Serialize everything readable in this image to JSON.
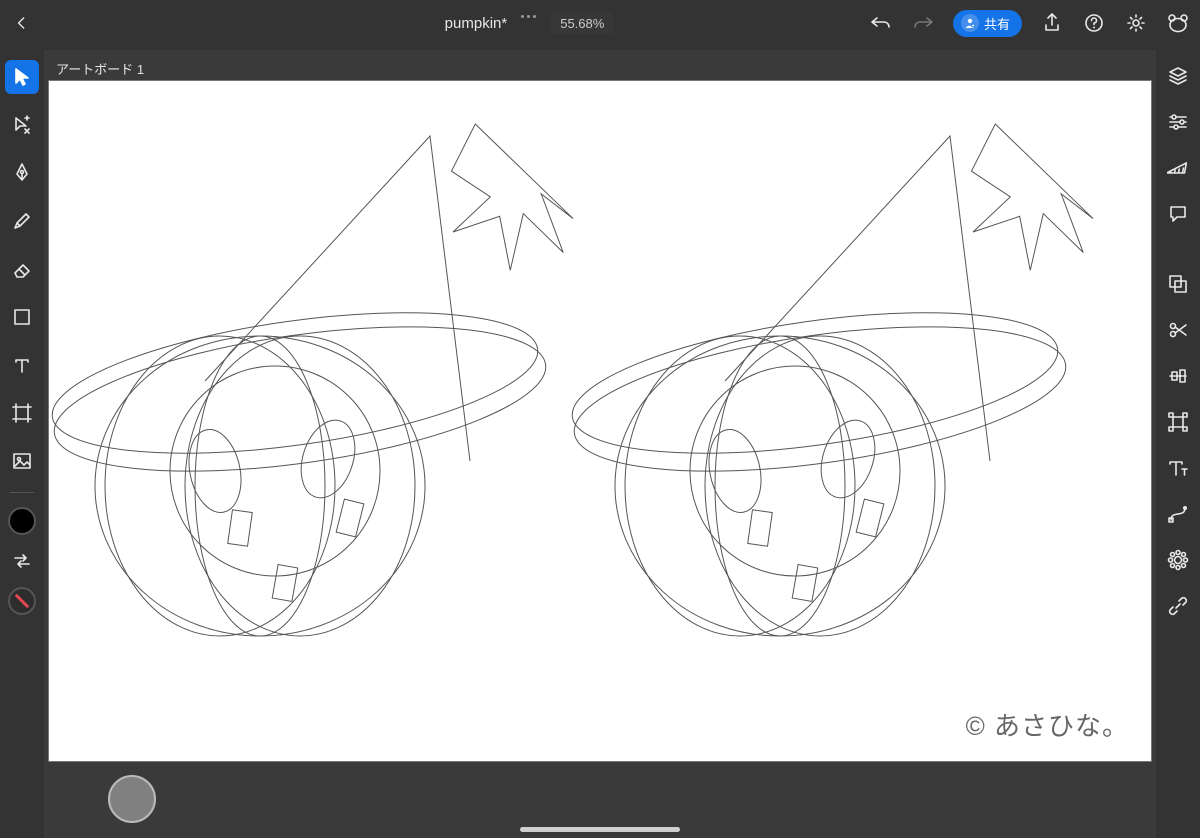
{
  "header": {
    "doc_title": "pumpkin*",
    "zoom": "55.68%",
    "share_label": "共有"
  },
  "artboard": {
    "label": "アートボード 1",
    "copyright": "© あさひな。"
  },
  "colors": {
    "accent": "#1473e6",
    "fill": "#000000",
    "stroke": "none",
    "bottom_chip": "#808080"
  },
  "left_tools": [
    {
      "name": "selection-tool",
      "selected": true
    },
    {
      "name": "direct-selection-tool",
      "selected": false
    },
    {
      "name": "pen-tool",
      "selected": false
    },
    {
      "name": "pencil-tool",
      "selected": false
    },
    {
      "name": "eraser-tool",
      "selected": false
    },
    {
      "name": "shape-tool",
      "selected": false
    },
    {
      "name": "type-tool",
      "selected": false
    },
    {
      "name": "artboard-tool",
      "selected": false
    },
    {
      "name": "place-image-tool",
      "selected": false
    }
  ],
  "right_panels": [
    {
      "name": "layers-panel-icon"
    },
    {
      "name": "properties-panel-icon"
    },
    {
      "name": "precision-panel-icon"
    },
    {
      "name": "comments-panel-icon"
    },
    {
      "name": "combine-shapes-icon"
    },
    {
      "name": "scissors-icon"
    },
    {
      "name": "align-icon"
    },
    {
      "name": "object-transform-icon"
    },
    {
      "name": "type-panel-icon"
    },
    {
      "name": "path-panel-icon"
    },
    {
      "name": "appearance-icon"
    },
    {
      "name": "link-icon"
    }
  ],
  "top_right_icons": [
    {
      "name": "undo-icon",
      "enabled": true
    },
    {
      "name": "redo-icon",
      "enabled": false
    }
  ]
}
